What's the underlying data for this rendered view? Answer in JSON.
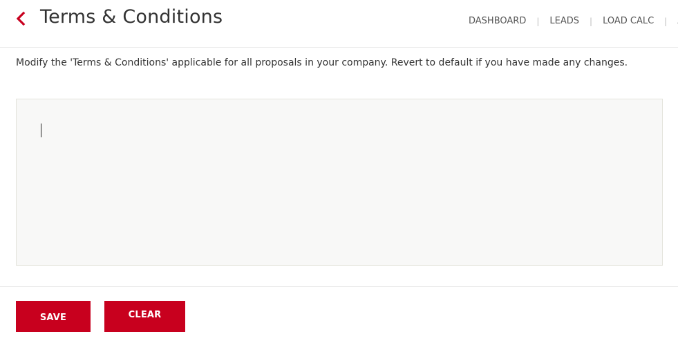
{
  "header": {
    "back_icon": "chevron-left-icon",
    "title": "Terms & Conditions",
    "nav": [
      {
        "label": "DASHBOARD"
      },
      {
        "label": "LEADS"
      },
      {
        "label": "LOAD CALC"
      },
      {
        "label": "AI"
      }
    ],
    "nav_separator": "|"
  },
  "main": {
    "description": "Modify the 'Terms & Conditions' applicable for all proposals in your company. Revert to default if you have made any changes.",
    "editor": {
      "value": "",
      "placeholder": ""
    }
  },
  "actions": {
    "save_label": "SAVE",
    "clear_label": "CLEAR"
  },
  "colors": {
    "accent": "#c8001e",
    "editor_bg": "#f8f8f7"
  }
}
